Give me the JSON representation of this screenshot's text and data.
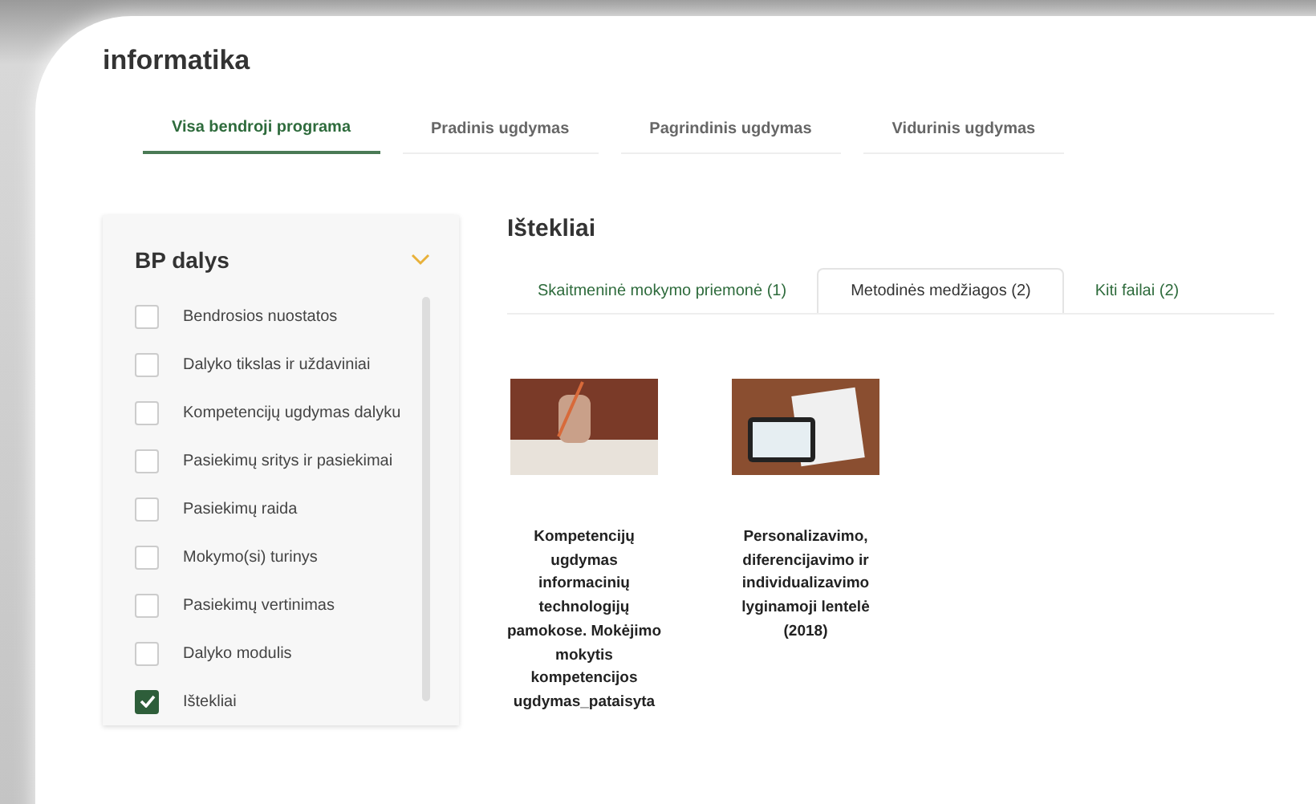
{
  "page_title": "informatika",
  "tabs": [
    {
      "label": "Visa bendroji programa",
      "selected": true
    },
    {
      "label": "Pradinis ugdymas",
      "selected": false
    },
    {
      "label": "Pagrindinis ugdymas",
      "selected": false
    },
    {
      "label": "Vidurinis ugdymas",
      "selected": false
    }
  ],
  "sidebar": {
    "title": "BP dalys",
    "expanded": true,
    "items": [
      {
        "label": "Bendrosios nuostatos",
        "checked": false
      },
      {
        "label": "Dalyko tikslas ir uždaviniai",
        "checked": false
      },
      {
        "label": "Kompetencijų ugdymas dalyku",
        "checked": false
      },
      {
        "label": "Pasiekimų sritys ir pasiekimai",
        "checked": false
      },
      {
        "label": "Pasiekimų raida",
        "checked": false
      },
      {
        "label": "Mokymo(si) turinys",
        "checked": false
      },
      {
        "label": "Pasiekimų vertinimas",
        "checked": false
      },
      {
        "label": "Dalyko modulis",
        "checked": false
      },
      {
        "label": "Ištekliai",
        "checked": true
      }
    ]
  },
  "resources": {
    "title": "Ištekliai",
    "tabs": [
      {
        "label": "Skaitmeninė mokymo priemonė (1)",
        "selected": false
      },
      {
        "label": "Metodinės medžiagos (2)",
        "selected": true
      },
      {
        "label": "Kiti failai (2)",
        "selected": false
      }
    ],
    "cards": [
      {
        "title": "Kompetencijų ugdymas informacinių technologijų pamokose. Mokėjimo mokytis kompetencijos ugdymas_pataisyta",
        "kind": "writing"
      },
      {
        "title": "Personalizavimo, diferencijavimo ir individualizavimo lyginamoji lentelė (2018)",
        "kind": "tablet"
      }
    ]
  }
}
